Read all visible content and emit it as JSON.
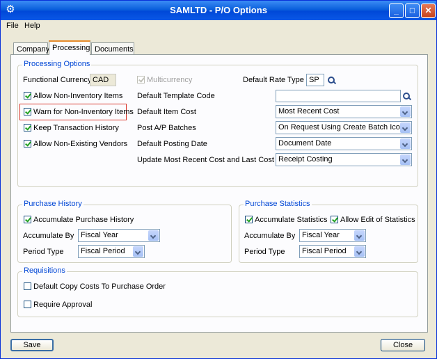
{
  "window": {
    "title": "SAMLTD - P/O Options"
  },
  "menu": {
    "file": "File",
    "help": "Help"
  },
  "tabs": [
    {
      "label": "Company"
    },
    {
      "label": "Processing"
    },
    {
      "label": "Documents"
    }
  ],
  "processing_options": {
    "title": "Processing Options",
    "functional_currency_label": "Functional Currency",
    "functional_currency_value": "CAD",
    "multicurrency_label": "Multicurrency",
    "default_rate_type_label": "Default Rate Type",
    "default_rate_type_value": "SP",
    "allow_non_inventory_label": "Allow Non-Inventory Items",
    "warn_non_inventory_label": "Warn for Non-Inventory Items",
    "keep_history_label": "Keep Transaction History",
    "allow_non_existing_vendors_label": "Allow Non-Existing Vendors",
    "default_template_code_label": "Default Template Code",
    "default_template_code_value": "",
    "default_item_cost_label": "Default Item Cost",
    "default_item_cost_value": "Most Recent Cost",
    "post_ap_batches_label": "Post A/P Batches",
    "post_ap_batches_value": "On Request Using Create Batch Icon",
    "default_posting_date_label": "Default Posting Date",
    "default_posting_date_value": "Document Date",
    "update_recent_cost_label": "Update Most Recent Cost and Last Cost At",
    "update_recent_cost_value": "Receipt Costing"
  },
  "purchase_history": {
    "title": "Purchase History",
    "accumulate_label": "Accumulate Purchase History",
    "accumulate_by_label": "Accumulate By",
    "accumulate_by_value": "Fiscal Year",
    "period_type_label": "Period Type",
    "period_type_value": "Fiscal Period"
  },
  "purchase_statistics": {
    "title": "Purchase Statistics",
    "accumulate_label": "Accumulate Statistics",
    "allow_edit_label": "Allow Edit of Statistics",
    "accumulate_by_label": "Accumulate By",
    "accumulate_by_value": "Fiscal Year",
    "period_type_label": "Period Type",
    "period_type_value": "Fiscal Period"
  },
  "requisitions": {
    "title": "Requisitions",
    "default_copy_costs_label": "Default Copy Costs To Purchase Order",
    "require_approval_label": "Require Approval"
  },
  "buttons": {
    "save": "Save",
    "close": "Close"
  },
  "colors": {
    "titlebar": "#0a5fdc",
    "group_title": "#0046d5",
    "highlight": "#d9352a",
    "check": "#21a121"
  }
}
